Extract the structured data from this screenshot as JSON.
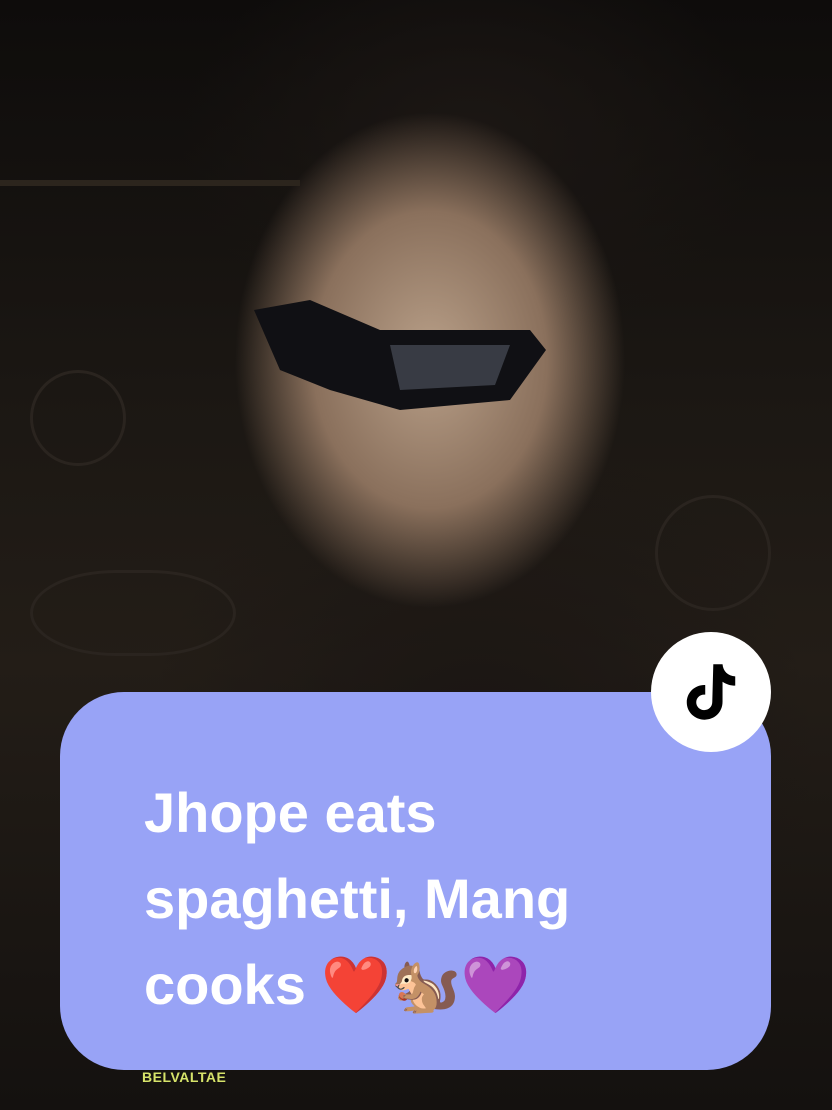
{
  "post": {
    "caption": "Jhope eats spaghetti, Mang cooks ❤️🐿️💜",
    "watermark": "BELVALTAE"
  },
  "badge": {
    "icon": "tiktok-logo-icon"
  },
  "colors": {
    "card_background": "#98a3f6",
    "caption_text": "#ffffff",
    "watermark_text": "#d6e36a"
  }
}
